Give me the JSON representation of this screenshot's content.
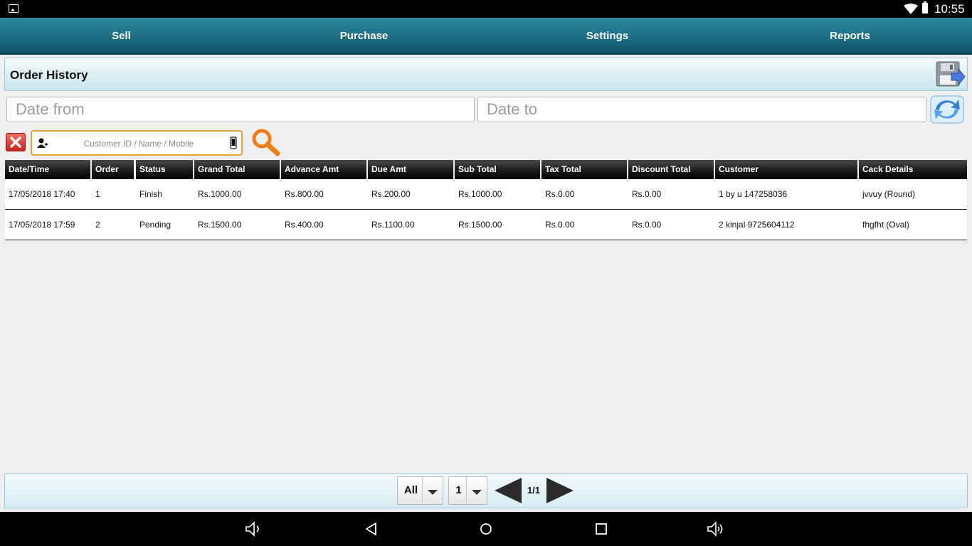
{
  "status_bar": {
    "time": "10:55"
  },
  "nav": {
    "tabs": [
      "Sell",
      "Purchase",
      "Settings",
      "Reports"
    ]
  },
  "page": {
    "title": "Order History"
  },
  "filters": {
    "date_from_placeholder": "Date from",
    "date_to_placeholder": "Date to",
    "customer_placeholder": "Customer ID / Name / Mobile"
  },
  "table": {
    "headers": [
      "Date/Time",
      "Order",
      "Status",
      "Grand Total",
      "Advance Amt",
      "Due Amt",
      "Sub Total",
      "Tax Total",
      "Discount Total",
      "Customer",
      "Cack Details"
    ],
    "rows": [
      [
        "17/05/2018 17:40",
        "1",
        "Finish",
        "Rs.1000.00",
        "Rs.800.00",
        "Rs.200.00",
        "Rs.1000.00",
        "Rs.0.00",
        "Rs.0.00",
        "1 by u 147258036",
        "jvvuy (Round)"
      ],
      [
        "17/05/2018 17:59",
        "2",
        "Pending",
        "Rs.1500.00",
        "Rs.400.00",
        "Rs.1100.00",
        "Rs.1500.00",
        "Rs.0.00",
        "Rs.0.00",
        "2 kinjal 9725604112",
        "fhgfht (Oval)"
      ]
    ]
  },
  "pager": {
    "filter_value": "All",
    "page_select": "1",
    "page_info": "1/1"
  },
  "colors": {
    "nav_teal": "#1f7289",
    "search_accent": "#e3a33a",
    "clear_red": "#c9231b",
    "search_orange": "#f07c12"
  }
}
